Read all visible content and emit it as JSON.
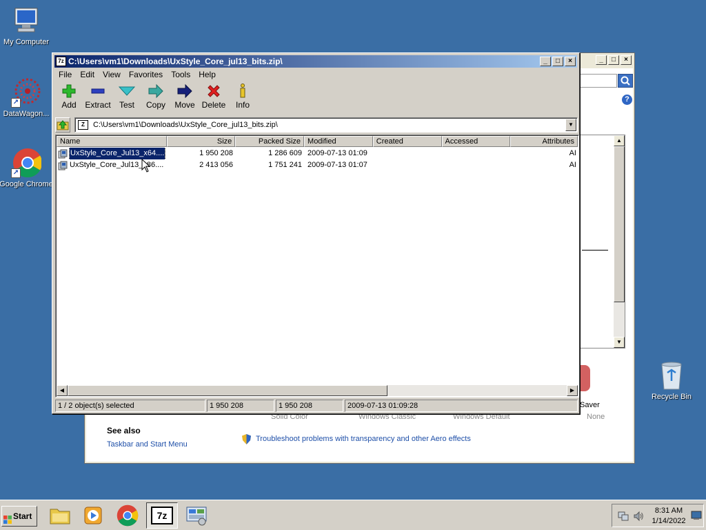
{
  "desktop": {
    "icons": [
      {
        "label": "My Computer"
      },
      {
        "label": "DataWagon..."
      },
      {
        "label": "Google Chrome"
      },
      {
        "label": "Recycle Bin"
      }
    ]
  },
  "background_window": {
    "screensaver_label": "Saver",
    "theme_captions": [
      "Solid Color",
      "Windows Classic",
      "Windows Default",
      "None"
    ],
    "see_also": {
      "heading": "See also",
      "link": "Taskbar and Start Menu"
    },
    "troubleshoot_link": "Troubleshoot problems with transparency and other Aero effects"
  },
  "zip_window": {
    "app_icon": "7z",
    "title": "C:\\Users\\vm1\\Downloads\\UxStyle_Core_jul13_bits.zip\\",
    "menu": [
      "File",
      "Edit",
      "View",
      "Favorites",
      "Tools",
      "Help"
    ],
    "toolbar": [
      {
        "label": "Add",
        "icon": "plus-icon"
      },
      {
        "label": "Extract",
        "icon": "minus-icon"
      },
      {
        "label": "Test",
        "icon": "check-icon"
      },
      {
        "label": "Copy",
        "icon": "copy-arrow-icon"
      },
      {
        "label": "Move",
        "icon": "move-arrow-icon"
      },
      {
        "label": "Delete",
        "icon": "delete-x-icon"
      },
      {
        "label": "Info",
        "icon": "info-icon"
      }
    ],
    "address": "C:\\Users\\vm1\\Downloads\\UxStyle_Core_jul13_bits.zip\\",
    "columns": [
      "Name",
      "Size",
      "Packed Size",
      "Modified",
      "Created",
      "Accessed",
      "Attributes"
    ],
    "rows": [
      {
        "name": "UxStyle_Core_Jul13_x64....",
        "size": "1 950 208",
        "packed": "1 286 609",
        "modified": "2009-07-13 01:09",
        "created": "",
        "accessed": "",
        "attributes": "AI",
        "selected": true
      },
      {
        "name": "UxStyle_Core_Jul13_x86....",
        "size": "2 413 056",
        "packed": "1 751 241",
        "modified": "2009-07-13 01:07",
        "created": "",
        "accessed": "",
        "attributes": "AI",
        "selected": false
      }
    ],
    "status": [
      "1 / 2 object(s) selected",
      "1 950 208",
      "1 950 208",
      "2009-07-13 01:09:28"
    ]
  },
  "taskbar": {
    "start_label": "Start",
    "apps": [
      "file-explorer",
      "media-player",
      "chrome",
      "7-zip",
      "control-panel"
    ],
    "active_app": "7-zip",
    "time": "8:31 AM",
    "date": "1/14/2022"
  }
}
